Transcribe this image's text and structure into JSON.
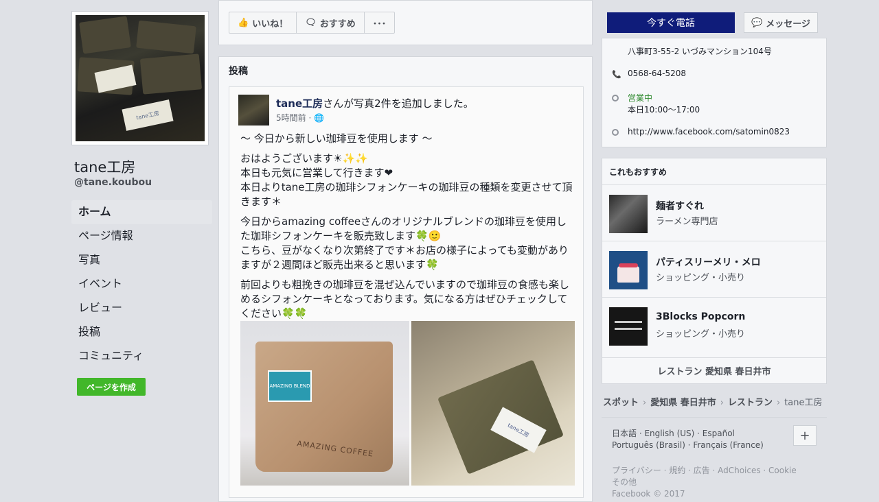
{
  "page": {
    "name": "tane工房",
    "handle": "@tane.koubou"
  },
  "cover": {
    "tag_text": "tane工房"
  },
  "sidebar": {
    "items": [
      {
        "label": "ホーム"
      },
      {
        "label": "ページ情報"
      },
      {
        "label": "写真"
      },
      {
        "label": "イベント"
      },
      {
        "label": "レビュー"
      },
      {
        "label": "投稿"
      },
      {
        "label": "コミュニティ"
      }
    ],
    "create_page_label": "ページを作成"
  },
  "actions": {
    "like_label": "いいね！",
    "recommend_label": "おすすめ",
    "more_label": "･･･",
    "call_label": "今すぐ電話",
    "message_label": "メッセージ"
  },
  "posts_section": {
    "title": "投稿"
  },
  "post": {
    "author": "tane工房",
    "action_text": "さんが写真2件を追加しました。",
    "time": "5時間前 · ",
    "paragraphs": [
      "～ 今日から新しい珈琲豆を使用します ～",
      "おはようございます☀✨✨\n本日も元気に営業して行きます❤\n本日よりtane工房の珈琲シフォンケーキの珈琲豆の種類を変更させて頂きます＊",
      "今日からamazing coffeeさんのオリジナルブレンドの珈琲豆を使用した珈琲シフォンケーキを販売致します🍀🙂\nこちら、豆がなくなり次第終了です＊お店の様子によっても変動がありますが２週間ほど販売出来ると思います🍀",
      "前回よりも粗挽きの珈琲豆を混ぜ込んでいますので珈琲豆の食感も楽しめるシフォンケーキとなっております。気になる方はぜひチェックしてください🍀🍀"
    ],
    "photo1_label": "AMAZING COFFEE",
    "photo1_blend": "AMAZING BLEND",
    "photo2_tag": "tane工房"
  },
  "info": {
    "address": "八事町3-55-2 いづみマンション104号",
    "phone": "0568-64-5208",
    "status": "営業中",
    "hours": "本日10:00～17:00",
    "website": "http://www.facebook.com/satomin0823"
  },
  "recommendations": {
    "title": "これもおすすめ",
    "items": [
      {
        "name": "麺者すぐれ",
        "category": "ラーメン専門店"
      },
      {
        "name": "パティスリーメリ・メロ",
        "category": "ショッピング・小売り"
      },
      {
        "name": "3Blocks Popcorn",
        "category": "ショッピング・小売り"
      }
    ],
    "footer": "レストラン 愛知県 春日井市"
  },
  "breadcrumb": [
    "スポット",
    "愛知県 春日井市",
    "レストラン",
    "tane工房"
  ],
  "languages": {
    "line1": "日本語 · English (US) · Español",
    "line2": "Português (Brasil) · Français (France)"
  },
  "footer": {
    "links": "プライバシー · 規約 · 広告 · AdChoices · Cookie",
    "more": "その他",
    "copyright": "Facebook © 2017"
  },
  "colors": {
    "call_button": "#0f1c7a",
    "create_button": "#42b72a",
    "link_blue": "#1c2b57"
  }
}
